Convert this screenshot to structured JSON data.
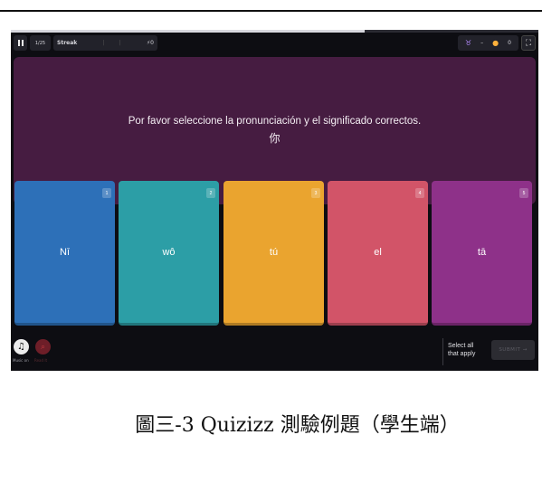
{
  "progress": {
    "fraction": 0.67
  },
  "topbar": {
    "question_count": "1/25",
    "streak_label": "Streak",
    "streak_ticks": [
      "|",
      "|"
    ],
    "streak_points": "⚡0",
    "powerup_value": "–",
    "coins": "0"
  },
  "question": {
    "text": "Por favor seleccione la pronunciación y el significado correctos.",
    "character": "你"
  },
  "options": [
    {
      "num": "1",
      "label": "Nī",
      "color": "#2d70b8"
    },
    {
      "num": "2",
      "label": "wô",
      "color": "#2c9ea6"
    },
    {
      "num": "3",
      "label": "tú",
      "color": "#eaa42f"
    },
    {
      "num": "4",
      "label": "el",
      "color": "#d25468"
    },
    {
      "num": "5",
      "label": "tā",
      "color": "#8e3189"
    }
  ],
  "bottom": {
    "music_label": "Music on",
    "read_label": "Read It",
    "select_all": "Select all that apply",
    "submit_label": "SUBMIT →"
  },
  "caption": "圖三-3 Quizizz 測驗例題（學生端）"
}
